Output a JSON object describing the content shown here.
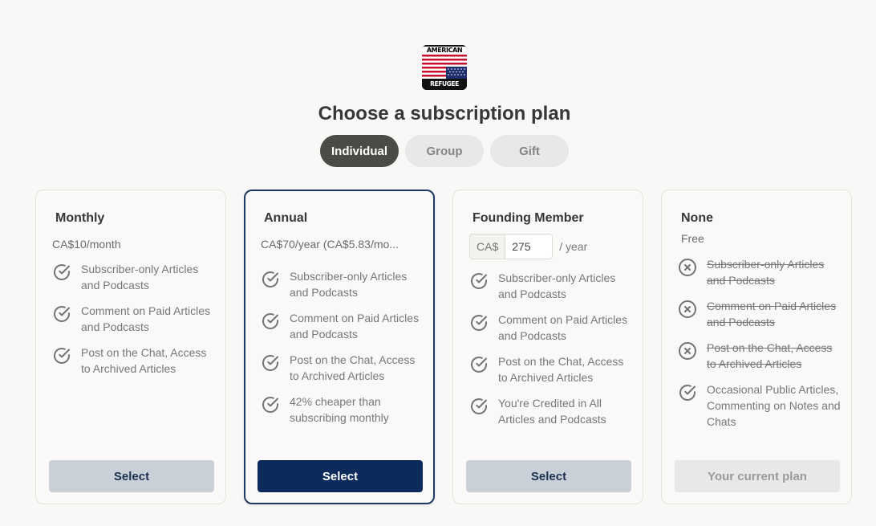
{
  "logo": {
    "top_text": "AMERICAN",
    "bottom_text": "REFUGEE",
    "alt": "American Refugee logo"
  },
  "heading": "Choose a subscription plan",
  "tabs": [
    {
      "label": "Individual",
      "active": true
    },
    {
      "label": "Group",
      "active": false
    },
    {
      "label": "Gift",
      "active": false
    }
  ],
  "plans": [
    {
      "name": "Monthly",
      "price": "CA$10/month",
      "features": [
        {
          "text": "Subscriber-only Articles and Podcasts",
          "included": true
        },
        {
          "text": "Comment on Paid Articles and Podcasts",
          "included": true
        },
        {
          "text": "Post on the Chat, Access to Archived Articles",
          "included": true
        }
      ],
      "button": "Select"
    },
    {
      "name": "Annual",
      "price": "CA$70/year (CA$5.83/mo...",
      "features": [
        {
          "text": "Subscriber-only Articles and Podcasts",
          "included": true
        },
        {
          "text": "Comment on Paid Articles and Podcasts",
          "included": true
        },
        {
          "text": "Post on the Chat, Access to Archived Articles",
          "included": true
        },
        {
          "text": "42% cheaper than subscribing monthly",
          "included": true
        }
      ],
      "button": "Select"
    },
    {
      "name": "Founding Member",
      "currency_label": "CA$",
      "amount_value": "275",
      "amount_suffix": "/ year",
      "features": [
        {
          "text": "Subscriber-only Articles and Podcasts",
          "included": true
        },
        {
          "text": "Comment on Paid Articles and Podcasts",
          "included": true
        },
        {
          "text": "Post on the Chat, Access to Archived Articles",
          "included": true
        },
        {
          "text": "You're Credited in All Articles and Podcasts",
          "included": true
        }
      ],
      "button": "Select"
    },
    {
      "name": "None",
      "price": "Free",
      "features": [
        {
          "text": "Subscriber-only Articles and Podcasts",
          "included": false
        },
        {
          "text": "Comment on Paid Articles and Podcasts",
          "included": false
        },
        {
          "text": "Post on the Chat, Access to Archived Articles",
          "included": false
        },
        {
          "text": "Occasional Public Articles, Commenting on Notes and Chats",
          "included": true
        }
      ],
      "button": "Your current plan"
    }
  ],
  "colors": {
    "background": "#f9f8f6",
    "accent_navy": "#0c2a5b",
    "active_tab": "#4c4a44",
    "button_light": "#c9d0d8"
  }
}
